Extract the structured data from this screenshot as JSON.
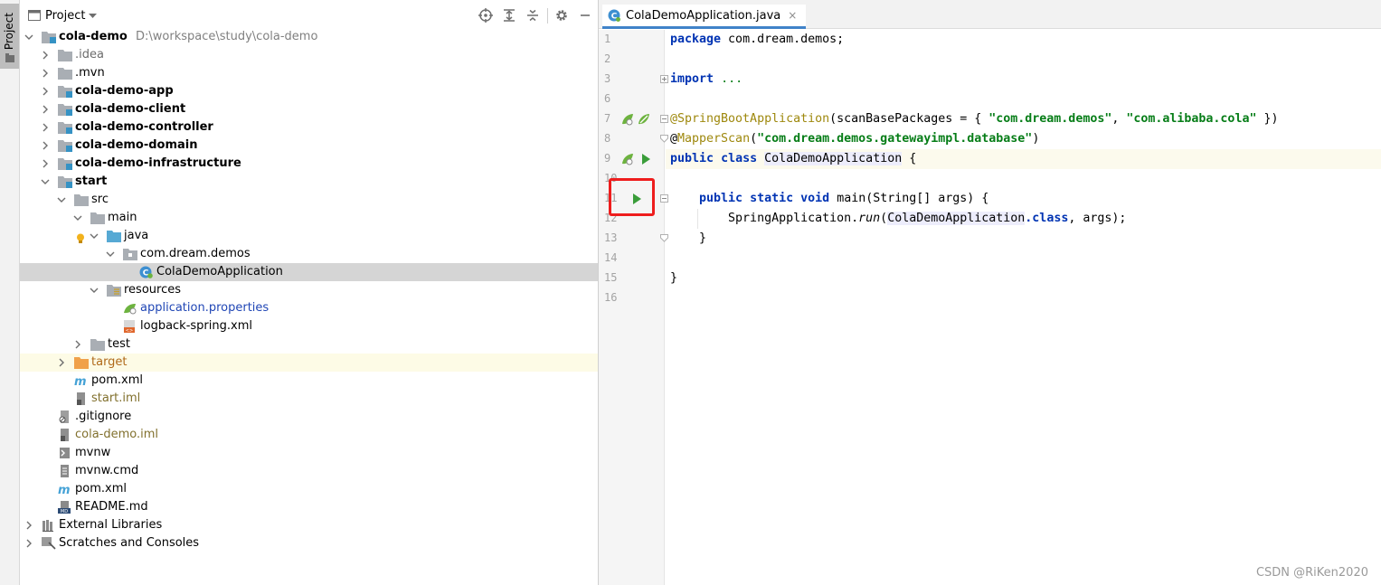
{
  "sidebar_strip": {
    "tab_label": "Project"
  },
  "project_panel": {
    "title": "Project",
    "header_icons": [
      "crosshair-icon",
      "expand-all-icon",
      "collapse-all-icon",
      "gear-icon",
      "minimize-icon"
    ],
    "tree": [
      {
        "label": "cola-demo",
        "path": "D:\\workspace\\study\\cola-demo",
        "depth": 0,
        "expanded": true,
        "icon": "module-folder-icon",
        "style": "bold"
      },
      {
        "label": ".idea",
        "depth": 1,
        "expanded": false,
        "icon": "folder-icon",
        "style": "gray"
      },
      {
        "label": ".mvn",
        "depth": 1,
        "expanded": false,
        "icon": "folder-icon",
        "style": "normal"
      },
      {
        "label": "cola-demo-app",
        "depth": 1,
        "expanded": false,
        "icon": "module-folder-icon",
        "style": "bold"
      },
      {
        "label": "cola-demo-client",
        "depth": 1,
        "expanded": false,
        "icon": "module-folder-icon",
        "style": "bold"
      },
      {
        "label": "cola-demo-controller",
        "depth": 1,
        "expanded": false,
        "icon": "module-folder-icon",
        "style": "bold"
      },
      {
        "label": "cola-demo-domain",
        "depth": 1,
        "expanded": false,
        "icon": "module-folder-icon",
        "style": "bold"
      },
      {
        "label": "cola-demo-infrastructure",
        "depth": 1,
        "expanded": false,
        "icon": "module-folder-icon",
        "style": "bold"
      },
      {
        "label": "start",
        "depth": 1,
        "expanded": true,
        "icon": "module-folder-icon",
        "style": "bold"
      },
      {
        "label": "src",
        "depth": 2,
        "expanded": true,
        "icon": "folder-icon",
        "style": "normal"
      },
      {
        "label": "main",
        "depth": 3,
        "expanded": true,
        "icon": "folder-icon",
        "style": "normal"
      },
      {
        "label": "java",
        "depth": 4,
        "expanded": true,
        "icon": "source-folder-icon",
        "style": "normal"
      },
      {
        "label": "com.dream.demos",
        "depth": 5,
        "expanded": true,
        "icon": "package-icon",
        "style": "normal"
      },
      {
        "label": "ColaDemoApplication",
        "depth": 6,
        "icon": "spring-class-icon",
        "style": "normal",
        "selected": true
      },
      {
        "label": "resources",
        "depth": 4,
        "expanded": true,
        "icon": "resources-folder-icon",
        "style": "normal"
      },
      {
        "label": "application.properties",
        "depth": 5,
        "icon": "spring-properties-icon",
        "style": "blue"
      },
      {
        "label": "logback-spring.xml",
        "depth": 5,
        "icon": "xml-file-icon",
        "style": "normal"
      },
      {
        "label": "test",
        "depth": 3,
        "expanded": false,
        "icon": "folder-icon",
        "style": "normal"
      },
      {
        "label": "target",
        "depth": 2,
        "expanded": false,
        "icon": "excluded-folder-icon",
        "style": "orange",
        "excluded": true
      },
      {
        "label": "pom.xml",
        "depth": 2,
        "icon": "maven-icon",
        "style": "normal"
      },
      {
        "label": "start.iml",
        "depth": 2,
        "icon": "iml-file-icon",
        "style": "olive"
      },
      {
        "label": ".gitignore",
        "depth": 1,
        "icon": "gitignore-icon",
        "style": "normal"
      },
      {
        "label": "cola-demo.iml",
        "depth": 1,
        "icon": "iml-file-icon",
        "style": "olive"
      },
      {
        "label": "mvnw",
        "depth": 1,
        "icon": "shell-file-icon",
        "style": "normal"
      },
      {
        "label": "mvnw.cmd",
        "depth": 1,
        "icon": "text-file-icon",
        "style": "normal"
      },
      {
        "label": "pom.xml",
        "depth": 1,
        "icon": "maven-icon",
        "style": "normal"
      },
      {
        "label": "README.md",
        "depth": 1,
        "icon": "markdown-icon",
        "style": "normal"
      },
      {
        "label": "External Libraries",
        "depth": 0,
        "expanded": false,
        "icon": "libraries-icon",
        "style": "normal"
      },
      {
        "label": "Scratches and Consoles",
        "depth": 0,
        "expanded": false,
        "icon": "scratches-icon",
        "style": "normal"
      }
    ]
  },
  "editor": {
    "tab": {
      "label": "ColaDemoApplication.java",
      "close": "×"
    },
    "lines": [
      {
        "n": "1",
        "tokens": [
          [
            "kw",
            "package"
          ],
          [
            "",
            " com.dream.demos;"
          ]
        ]
      },
      {
        "n": "2",
        "tokens": []
      },
      {
        "n": "3",
        "tokens": [
          [
            "kw",
            "import"
          ],
          [
            "",
            " "
          ],
          [
            "fold",
            "..."
          ]
        ]
      },
      {
        "n": "6",
        "tokens": []
      },
      {
        "n": "7",
        "tokens": [
          [
            "ann",
            "@SpringBootApplication"
          ],
          [
            "",
            "(scanBasePackages = { "
          ],
          [
            "str",
            "\"com.dream.demos\""
          ],
          [
            "",
            ", "
          ],
          [
            "str",
            "\"com.alibaba.cola\""
          ],
          [
            "",
            " })"
          ]
        ]
      },
      {
        "n": "8",
        "tokens": [
          [
            "",
            "@"
          ],
          [
            "ann",
            "MapperScan"
          ],
          [
            "",
            "("
          ],
          [
            "str",
            "\"com.dream.demos.gatewayimpl.database\""
          ],
          [
            "",
            ")"
          ]
        ]
      },
      {
        "n": "9",
        "tokens": [
          [
            "kw",
            "public"
          ],
          [
            "",
            " "
          ],
          [
            "kw",
            "class"
          ],
          [
            "",
            " "
          ],
          [
            "hl",
            "ColaDemoApplication"
          ],
          [
            "",
            " {"
          ]
        ],
        "current": true
      },
      {
        "n": "10",
        "tokens": []
      },
      {
        "n": "11",
        "tokens": [
          [
            "",
            "    "
          ],
          [
            "kw",
            "public"
          ],
          [
            "",
            " "
          ],
          [
            "kw",
            "static"
          ],
          [
            "",
            " "
          ],
          [
            "kw",
            "void"
          ],
          [
            "",
            " main(String[] args) {"
          ]
        ]
      },
      {
        "n": "12",
        "tokens": [
          [
            "",
            "        SpringApplication."
          ],
          [
            "itl",
            "run"
          ],
          [
            "",
            "("
          ],
          [
            "hl",
            "ColaDemoApplication"
          ],
          [
            "kw",
            ".class"
          ],
          [
            "",
            ", args);"
          ]
        ]
      },
      {
        "n": "13",
        "tokens": [
          [
            "",
            "    }"
          ]
        ]
      },
      {
        "n": "14",
        "tokens": []
      },
      {
        "n": "15",
        "tokens": [
          [
            "",
            "}"
          ]
        ]
      },
      {
        "n": "16",
        "tokens": []
      }
    ]
  },
  "watermark": "CSDN @RiKen2020",
  "colors": {
    "accent": "#4083c9",
    "highlight_box": "#ee1d1d",
    "run_green": "#3a9d3a"
  }
}
